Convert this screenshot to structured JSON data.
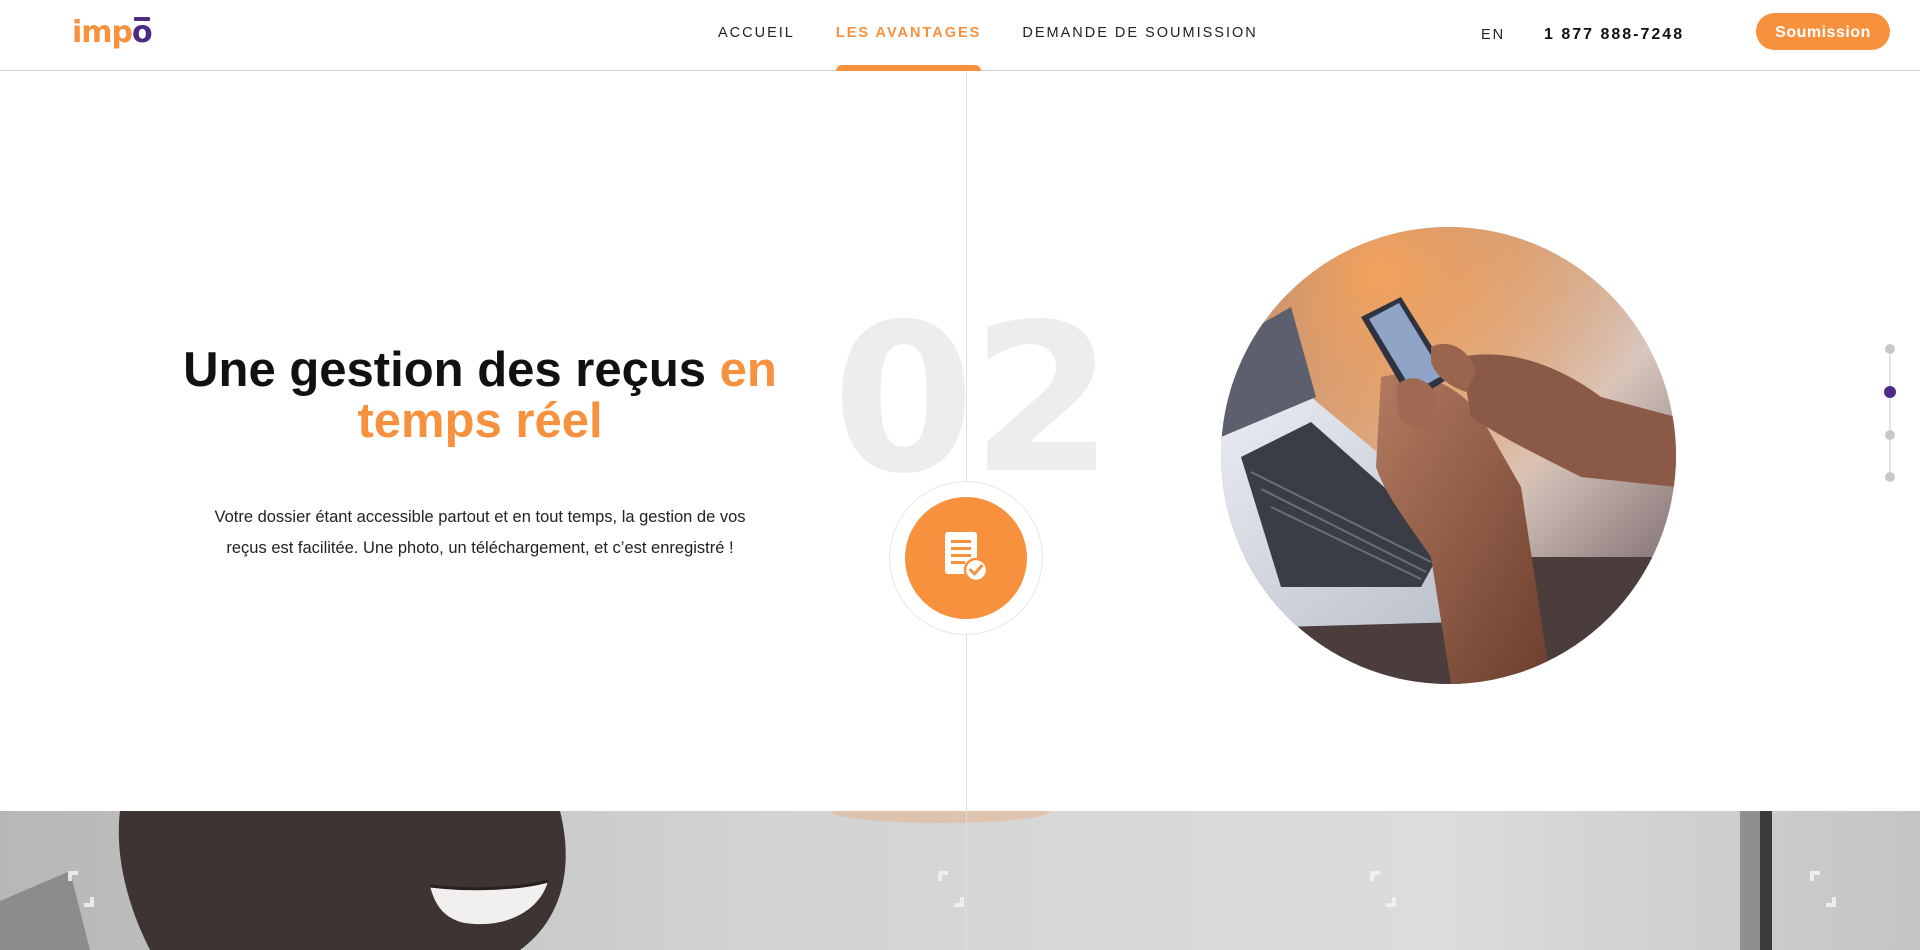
{
  "header": {
    "logo_text": "impo",
    "nav": [
      {
        "label": "ACCUEIL",
        "active": false
      },
      {
        "label": "LES AVANTAGES",
        "active": true
      },
      {
        "label": "DEMANDE DE SOUMISSION",
        "active": false
      }
    ],
    "language": "EN",
    "phone": "1 877 888-7248",
    "cta_label": "Soumission"
  },
  "hero": {
    "number": "02",
    "title_part1": "Une gestion des reçus",
    "title_highlight": "en temps réel",
    "description": "Votre dossier étant accessible partout et en tout temps, la gestion de vos reçus est facilitée. Une photo, un téléchargement, et c’est enregistré !",
    "icon": "receipt-check-icon",
    "image_alt": "hands-holding-phone-at-laptop-photo"
  },
  "pager": {
    "count": 4,
    "active_index": 1
  },
  "colors": {
    "brand_orange": "#f7913d",
    "brand_purple": "#4e2a84",
    "number_gray": "#ededed"
  }
}
